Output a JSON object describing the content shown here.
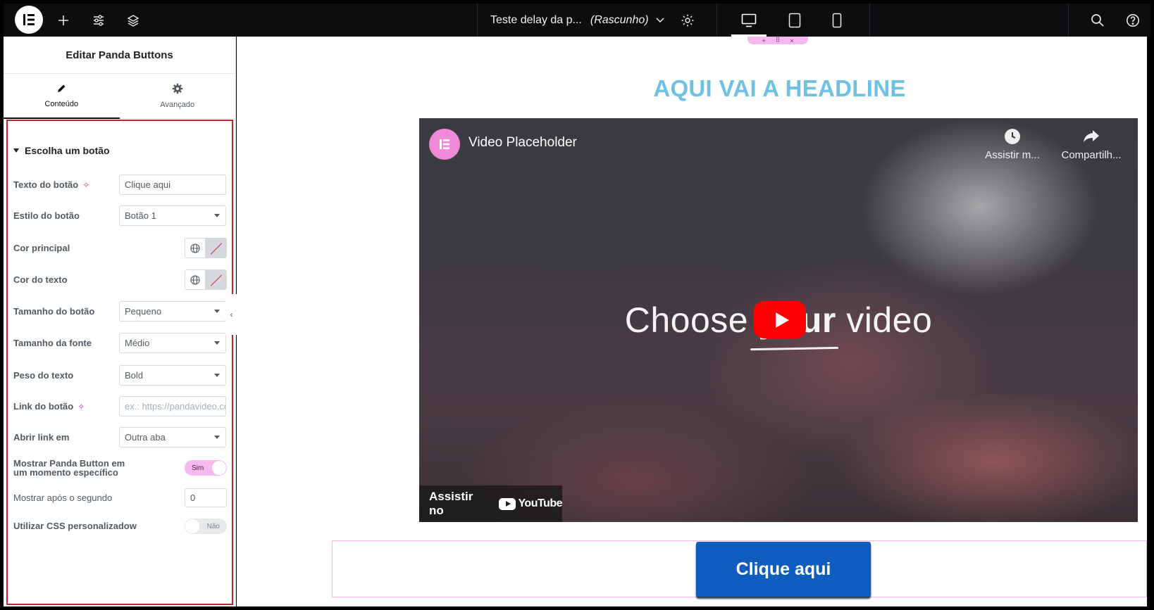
{
  "topbar": {
    "document_title": "Teste delay da p...",
    "status": "(Rascunho)",
    "icons": [
      "elementor-logo-icon",
      "add-icon",
      "sliders-icon",
      "layers-icon",
      "settings-gear-icon",
      "desktop-icon",
      "tablet-icon",
      "mobile-icon",
      "search-icon",
      "help-icon"
    ]
  },
  "panel": {
    "title": "Editar Panda Buttons",
    "tabs": [
      {
        "label": "Conteúdo",
        "icon": "pencil-icon",
        "active": true
      },
      {
        "label": "Avançado",
        "icon": "gear-icon",
        "active": false
      }
    ],
    "section_title": "Escolha um botão",
    "fields": {
      "button_text": {
        "label": "Texto do botão",
        "value": "Clique aqui"
      },
      "button_style": {
        "label": "Estilo do botão",
        "value": "Botão 1"
      },
      "main_color": {
        "label": "Cor principal"
      },
      "text_color": {
        "label": "Cor do texto"
      },
      "button_size": {
        "label": "Tamanho do botão",
        "value": "Pequeno"
      },
      "font_size": {
        "label": "Tamanho da fonte",
        "value": "Médio"
      },
      "font_weight": {
        "label": "Peso do texto",
        "value": "Bold"
      },
      "button_link": {
        "label": "Link do botão",
        "placeholder": "ex.: https://pandavideo.com"
      },
      "open_link_in": {
        "label": "Abrir link em",
        "value": "Outra aba"
      },
      "show_at_time": {
        "label_line1": "Mostrar Panda Button em",
        "label_line2": "um momento específico",
        "state": "Sim"
      },
      "show_after_seconds": {
        "label": "Mostrar após o segundo",
        "value": "0"
      },
      "custom_css": {
        "label": "Utilizar CSS personalizadow",
        "state": "Não"
      }
    }
  },
  "canvas": {
    "headline": "AQUI VAI A HEADLINE",
    "video": {
      "title": "Video Placeholder",
      "watch_later": "Assistir m...",
      "share": "Compartilh...",
      "center_text_start": "Choose ",
      "center_text_bold": "your",
      "center_text_end": " video",
      "watch_on": "Assistir no",
      "youtube": "YouTube"
    },
    "cta_label": "Clique aqui"
  },
  "colors": {
    "headline": "#6ec1e4",
    "cta": "#0e5dbf",
    "panel_highlight": "#c0262d",
    "toggle_on": "#f5b8ef",
    "elementor_pink": "#ef8ad9"
  }
}
